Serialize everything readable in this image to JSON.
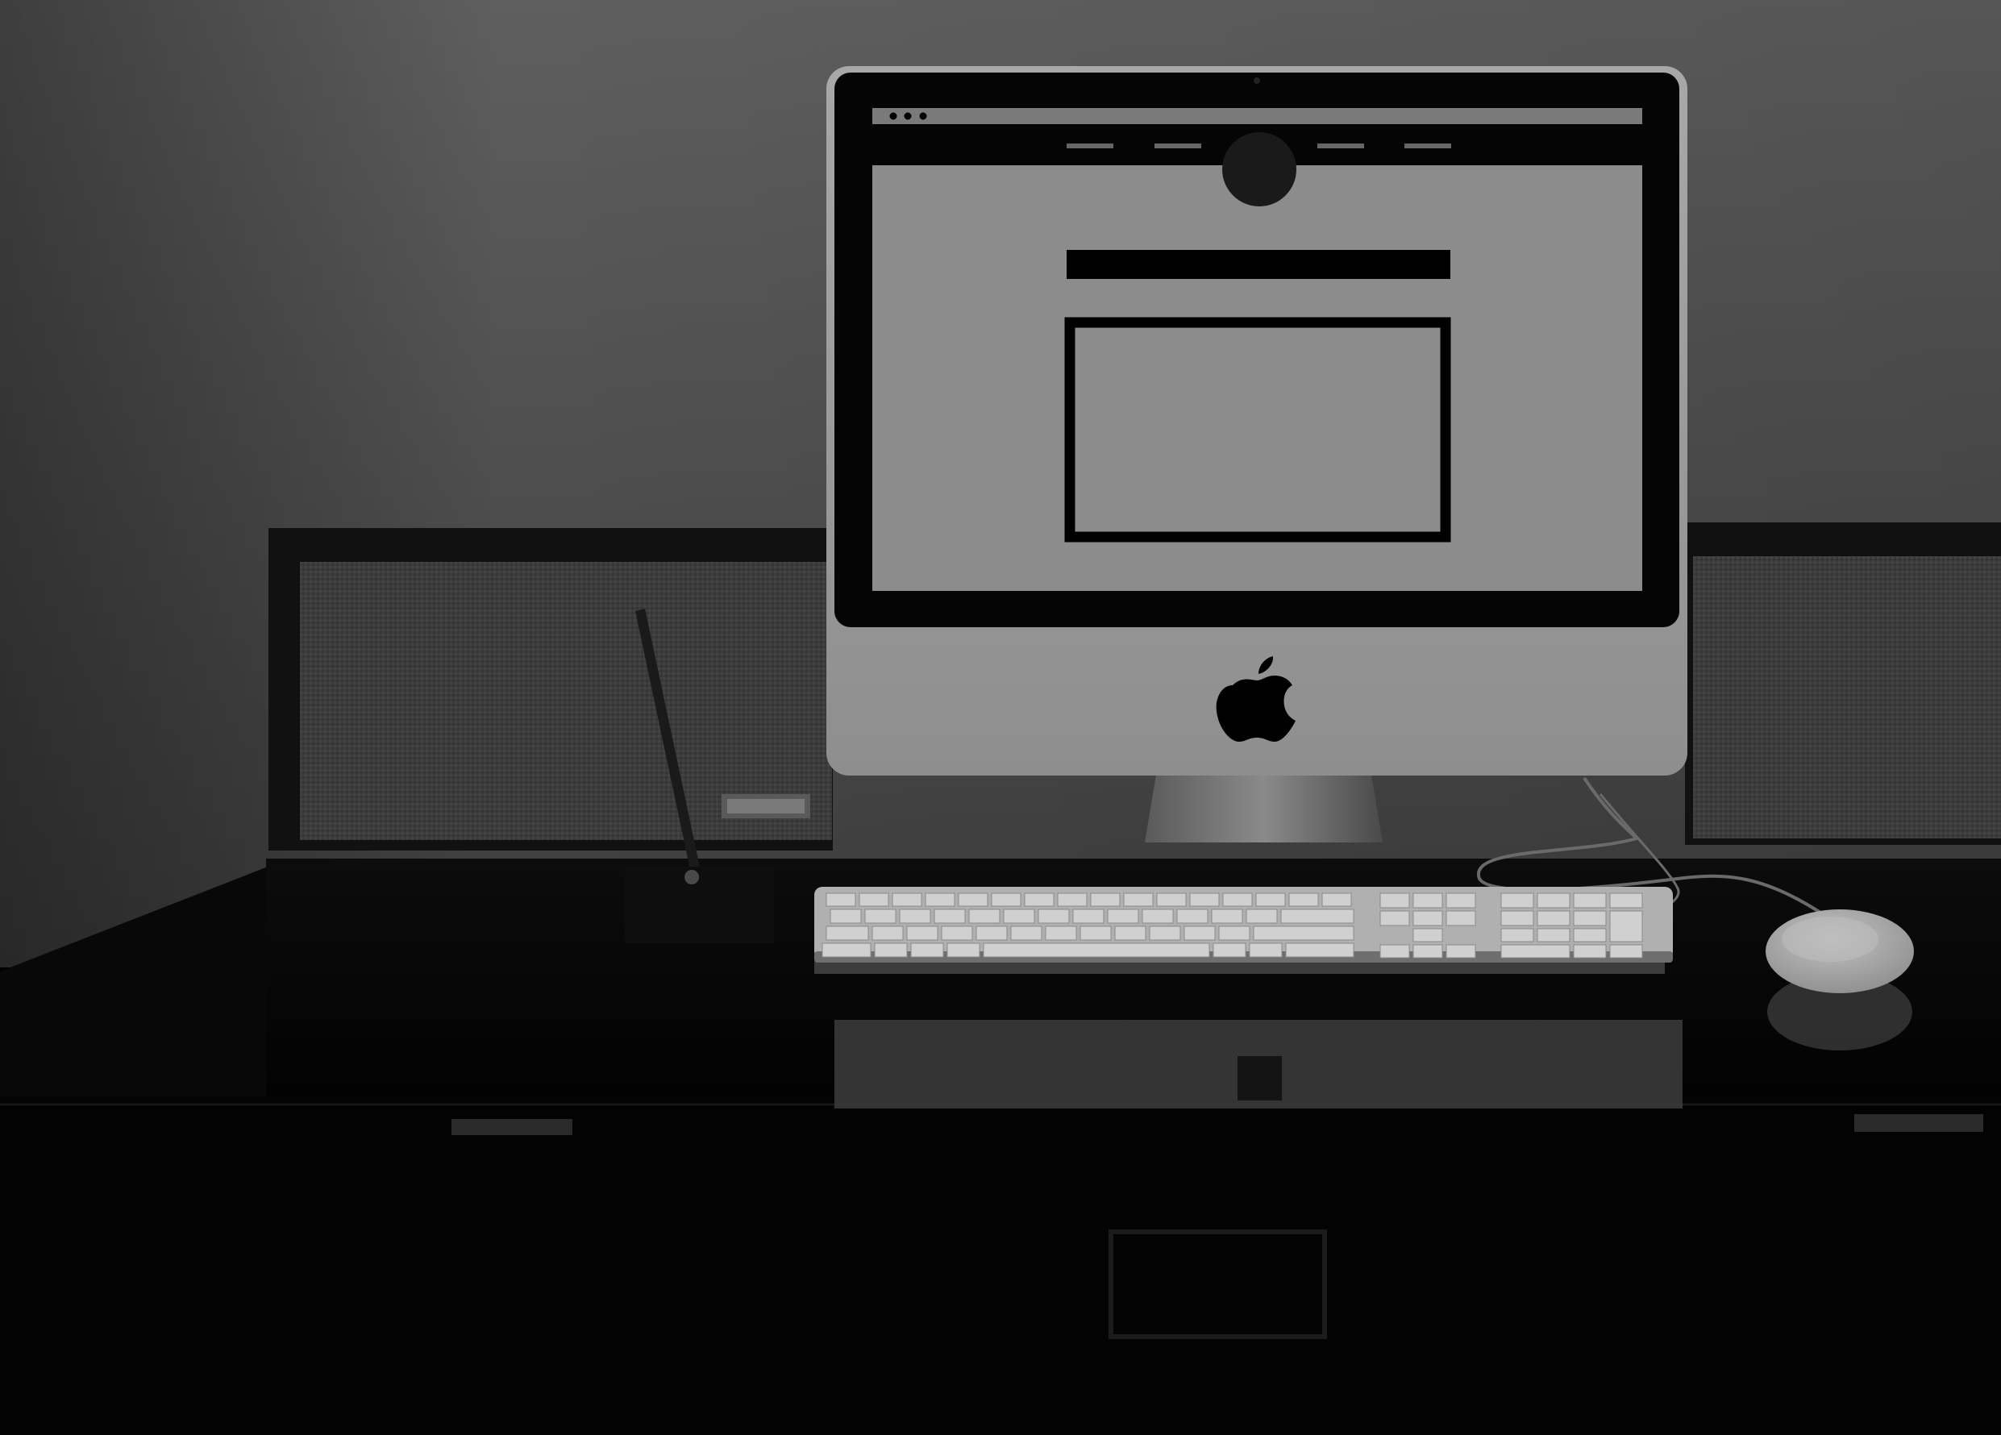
{
  "scene": {
    "palette": {
      "wall_top": "#5e5e5e",
      "wall_bottom": "#3a3a3a",
      "desk": "#050505",
      "bezel": "#9c9c9c",
      "screen_bg": "#8d8d8d",
      "screen_black": "#000000",
      "keyboard": "#a5a5a5",
      "mouse": "#ababab"
    },
    "icons": {
      "logo": "apple-logo-icon",
      "window_dots": "traffic-light-dots-icon",
      "nav_logo": "circle-logo-icon"
    },
    "mockup": {
      "window_controls_count": 3,
      "nav_links_count": 4,
      "has_heading_bar": true,
      "has_content_frame": true
    }
  }
}
